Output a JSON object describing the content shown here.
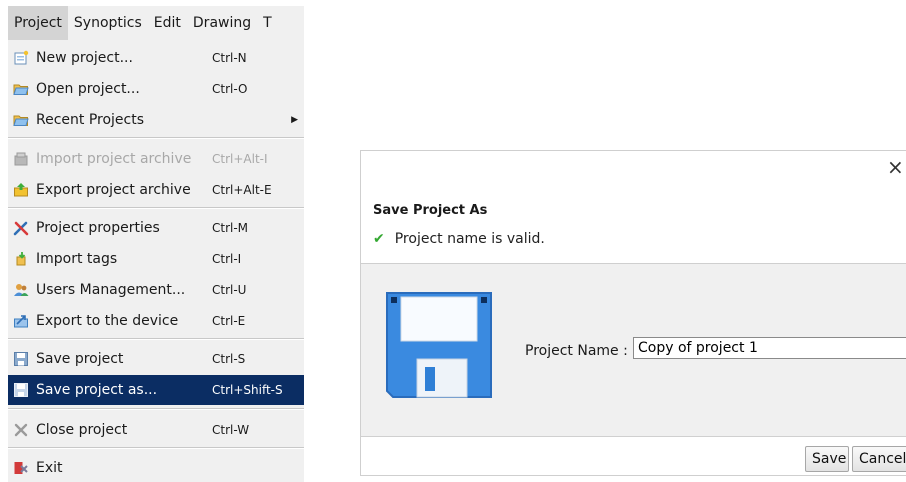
{
  "menubar": {
    "items": [
      "Project",
      "Synoptics",
      "Edit",
      "Drawing",
      "T"
    ]
  },
  "menu": {
    "items": [
      {
        "label": "New project...",
        "shortcut": "Ctrl-N",
        "icon": "new-project-icon"
      },
      {
        "label": "Open project...",
        "shortcut": "Ctrl-O",
        "icon": "open-folder-icon"
      },
      {
        "label": "Recent Projects",
        "shortcut": "",
        "icon": "folder-icon",
        "submenu": "▶"
      },
      {
        "label": "Import project archive",
        "shortcut": "Ctrl+Alt-I",
        "icon": "archive-icon",
        "disabled": true
      },
      {
        "label": "Export project archive",
        "shortcut": "Ctrl+Alt-E",
        "icon": "export-archive-icon"
      },
      {
        "label": "Project properties",
        "shortcut": "Ctrl-M",
        "icon": "tools-icon"
      },
      {
        "label": "Import tags",
        "shortcut": "Ctrl-I",
        "icon": "import-tags-icon"
      },
      {
        "label": "Users Management...",
        "shortcut": "Ctrl-U",
        "icon": "users-icon"
      },
      {
        "label": "Export to the device",
        "shortcut": "Ctrl-E",
        "icon": "export-device-icon"
      },
      {
        "label": "Save project",
        "shortcut": "Ctrl-S",
        "icon": "save-icon"
      },
      {
        "label": "Save project as...",
        "shortcut": "Ctrl+Shift-S",
        "icon": "save-as-icon",
        "selected": true
      },
      {
        "label": "Close project",
        "shortcut": "Ctrl-W",
        "icon": "close-project-icon"
      },
      {
        "label": "Exit",
        "shortcut": "",
        "icon": "exit-icon"
      }
    ]
  },
  "dialog": {
    "close_glyph": "×",
    "title": "Save Project As",
    "status_icon": "✔",
    "status_message": "Project name is valid.",
    "project_name_label": "Project Name :",
    "project_name_value": "Copy of project 1",
    "save_label": "Save",
    "cancel_label": "Cancel"
  },
  "colors": {
    "menu_bg": "#f0f0f0",
    "selected_bg": "#0b2d63",
    "valid_check": "#34a832",
    "floppy_blue": "#3a8ae0"
  }
}
